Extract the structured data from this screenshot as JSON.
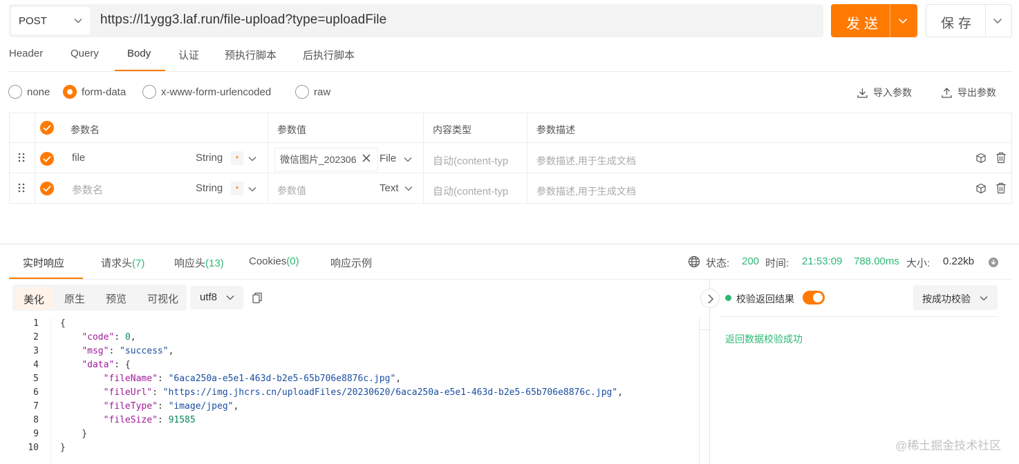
{
  "request": {
    "method": "POST",
    "url": "https://l1ygg3.laf.run/file-upload?type=uploadFile",
    "send_label": "发送",
    "save_label": "保存"
  },
  "request_tabs": [
    "Header",
    "Query",
    "Body",
    "认证",
    "预执行脚本",
    "后执行脚本"
  ],
  "active_request_tab": "Body",
  "body_types": [
    {
      "label": "none",
      "selected": false
    },
    {
      "label": "form-data",
      "selected": true
    },
    {
      "label": "x-www-form-urlencoded",
      "selected": false
    },
    {
      "label": "raw",
      "selected": false
    }
  ],
  "actions": {
    "import": "导入参数",
    "export": "导出参数"
  },
  "params_table": {
    "columns": [
      "参数名",
      "参数值",
      "内容类型",
      "参数描述"
    ],
    "rows": [
      {
        "name": "file",
        "name_is_placeholder": false,
        "type": "String",
        "required_mark": "*",
        "value": "微信图片_202306",
        "value_is_placeholder": false,
        "value_kind": "File",
        "content_type": "自动(content-typ",
        "description": "参数描述,用于生成文档"
      },
      {
        "name": "参数名",
        "name_is_placeholder": true,
        "type": "String",
        "required_mark": "*",
        "value": "参数值",
        "value_is_placeholder": true,
        "value_kind": "Text",
        "content_type": "自动(content-typ",
        "description": "参数描述,用于生成文档"
      }
    ]
  },
  "response_tabs": [
    {
      "label": "实时响应",
      "count": ""
    },
    {
      "label": "请求头",
      "count": "(7)"
    },
    {
      "label": "响应头",
      "count": "(13)"
    },
    {
      "label": "Cookies",
      "count": "(0)"
    },
    {
      "label": "响应示例",
      "count": ""
    }
  ],
  "status_bar": {
    "status_label": "状态:",
    "status_value": "200",
    "time_label": "时间:",
    "time_value": "21:53:09",
    "duration": "788.00ms",
    "size_label": "大小:",
    "size_value": "0.22kb"
  },
  "view_tabs": [
    "美化",
    "原生",
    "预览",
    "可视化"
  ],
  "active_view_tab": "美化",
  "encoding": "utf8",
  "code_lines": [
    "{",
    "    \"code\": 0,",
    "    \"msg\": \"success\",",
    "    \"data\": {",
    "        \"fileName\": \"6aca250a-e5e1-463d-b2e5-65b706e8876c.jpg\",",
    "        \"fileUrl\": \"https://img.jhcrs.cn/uploadFiles/20230620/6aca250a-e5e1-463d-b2e5-65b706e8876c.jpg\",",
    "        \"fileType\": \"image/jpeg\",",
    "        \"fileSize\": 91585",
    "    }",
    "}"
  ],
  "validation": {
    "label": "校验返回结果",
    "enabled": true,
    "mode": "按成功校验",
    "result": "返回数据校验成功"
  },
  "watermark": "@稀土掘金技术社区",
  "colors": {
    "accent": "#ff7a00",
    "success": "#2eb873"
  }
}
